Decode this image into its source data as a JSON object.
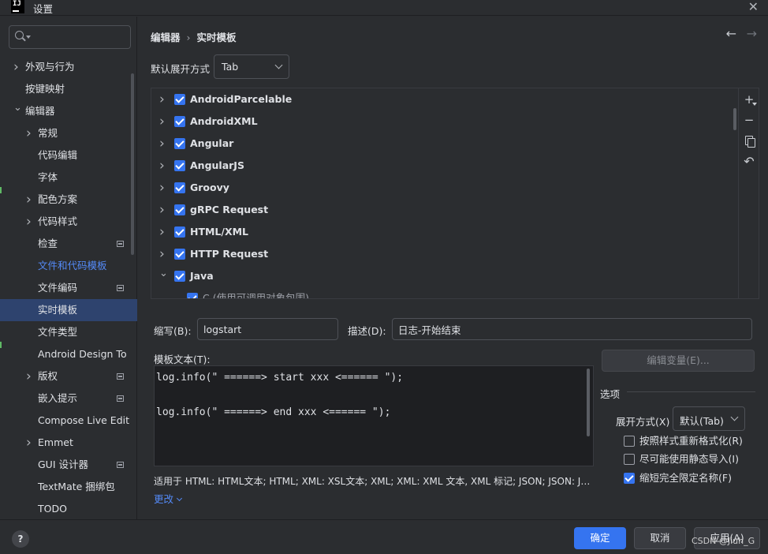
{
  "window": {
    "title": "设置",
    "app_icon_text": "IJ"
  },
  "sidebar": {
    "search": {
      "value": "",
      "placeholder": ""
    },
    "items": [
      {
        "label": "外观与行为",
        "level": 0,
        "chevron": "right"
      },
      {
        "label": "按键映射",
        "level": 0,
        "chevron": "none"
      },
      {
        "label": "编辑器",
        "level": 0,
        "chevron": "down"
      },
      {
        "label": "常规",
        "level": 1,
        "chevron": "right"
      },
      {
        "label": "代码编辑",
        "level": 1,
        "chevron": "none"
      },
      {
        "label": "字体",
        "level": 1,
        "chevron": "none"
      },
      {
        "label": "配色方案",
        "level": 1,
        "chevron": "right"
      },
      {
        "label": "代码样式",
        "level": 1,
        "chevron": "right"
      },
      {
        "label": "检查",
        "level": 1,
        "chevron": "none",
        "project_icon": true
      },
      {
        "label": "文件和代码模板",
        "level": 1,
        "chevron": "none",
        "link": true
      },
      {
        "label": "文件编码",
        "level": 1,
        "chevron": "none",
        "project_icon": true
      },
      {
        "label": "实时模板",
        "level": 1,
        "chevron": "none",
        "selected": true
      },
      {
        "label": "文件类型",
        "level": 1,
        "chevron": "none"
      },
      {
        "label": "Android Design To",
        "level": 1,
        "chevron": "none"
      },
      {
        "label": "版权",
        "level": 1,
        "chevron": "right",
        "project_icon": true
      },
      {
        "label": "嵌入提示",
        "level": 1,
        "chevron": "none",
        "project_icon": true
      },
      {
        "label": "Compose Live Edit",
        "level": 1,
        "chevron": "none"
      },
      {
        "label": "Emmet",
        "level": 1,
        "chevron": "right"
      },
      {
        "label": "GUI 设计器",
        "level": 1,
        "chevron": "none",
        "project_icon": true
      },
      {
        "label": "TextMate 捆绑包",
        "level": 1,
        "chevron": "none"
      },
      {
        "label": "TODO",
        "level": 1,
        "chevron": "none"
      }
    ]
  },
  "breadcrumb": {
    "parent": "编辑器",
    "separator": "›",
    "current": "实时模板"
  },
  "nav": {
    "back": "←",
    "forward": "→"
  },
  "expand_default": {
    "label": "默认展开方式",
    "value": "Tab"
  },
  "templates": {
    "groups": [
      {
        "name": "AndroidParcelable",
        "checked": true,
        "expanded": false
      },
      {
        "name": "AndroidXML",
        "checked": true,
        "expanded": false
      },
      {
        "name": "Angular",
        "checked": true,
        "expanded": false
      },
      {
        "name": "AngularJS",
        "checked": true,
        "expanded": false
      },
      {
        "name": "Groovy",
        "checked": true,
        "expanded": false
      },
      {
        "name": "gRPC Request",
        "checked": true,
        "expanded": false
      },
      {
        "name": "HTML/XML",
        "checked": true,
        "expanded": false
      },
      {
        "name": "HTTP Request",
        "checked": true,
        "expanded": false
      },
      {
        "name": "Java",
        "checked": true,
        "expanded": true
      }
    ],
    "partial_child": "C (使用可调用对象包围)",
    "tools": {
      "add": "+",
      "remove": "−",
      "copy": "",
      "revert": "↶"
    }
  },
  "form": {
    "abbr_label": "缩写(B):",
    "abbr_value": "logstart",
    "desc_label": "描述(D):",
    "desc_value": "日志-开始结束",
    "template_text_label": "模板文本(T):",
    "template_text": "log.info(\" ======> start xxx <====== \");\n\nlog.info(\" ======> end xxx <====== \");",
    "edit_variables_label": "编辑变量(E)...",
    "applies_text": "适用于 HTML: HTML文本; HTML; XML: XSL文本; XML; XML: XML 文本, XML 标记; JSON; JSON: JSON 字符串文本, JSON 属性键; Java",
    "change_label": "更改"
  },
  "options": {
    "title": "选项",
    "expand_with_label": "展开方式(X)",
    "expand_with_value": "默认(Tab)",
    "checkboxes": [
      {
        "label": "按照样式重新格式化(R)",
        "checked": false
      },
      {
        "label": "尽可能使用静态导入(I)",
        "checked": false
      },
      {
        "label": "缩短完全限定名称(F)",
        "checked": true
      }
    ]
  },
  "footer": {
    "help": "?",
    "ok": "确定",
    "cancel": "取消",
    "apply": "应用(A)",
    "watermark": "CSDN @Jiuh_G"
  },
  "colors": {
    "accent": "#3574f0",
    "selection": "#2e436e",
    "link": "#548af7",
    "background": "#2b2d30",
    "editor_bg": "#1e1f22"
  }
}
